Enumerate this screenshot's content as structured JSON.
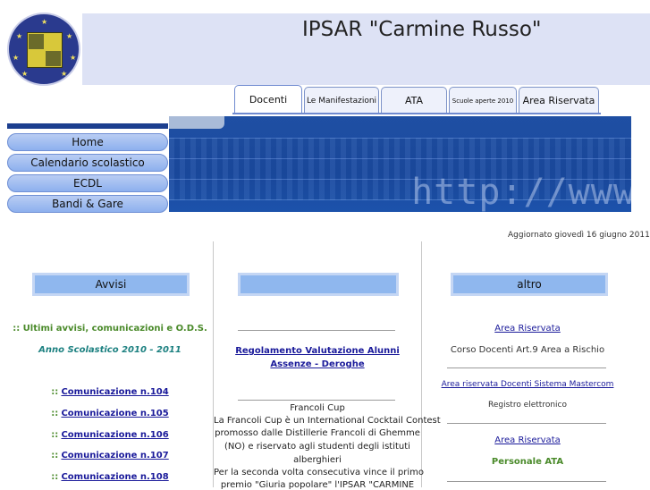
{
  "header": {
    "title": "IPSAR \"Carmine Russo\""
  },
  "tabs": [
    {
      "label": "Docenti",
      "active": true
    },
    {
      "label": "Le Manifestazioni"
    },
    {
      "label": "ATA"
    },
    {
      "label": "Scuole aperte 2010"
    },
    {
      "label": "Area Riservata"
    }
  ],
  "nav": {
    "items": [
      "Home",
      "Calendario scolastico",
      "ECDL",
      "Bandi & Gare"
    ]
  },
  "banner": {
    "text": "http://www."
  },
  "updated": "Aggiornato giovedì 16 giugno 2011",
  "left": {
    "header": "Avvisi",
    "subtitle": ":: Ultimi avvisi, comunicazioni  e O.D.S.",
    "year": "Anno Scolastico 2010 - 2011",
    "bullet": "::",
    "links": [
      "Comunicazione n.104",
      "Comunicazione n.105",
      "Comunicazione n.106",
      "Comunicazione n.107",
      "Comunicazione n.108"
    ]
  },
  "center": {
    "header": "",
    "link_line1": "Regolamento Valutazione Alunni",
    "link_line2": "Assenze - Deroghe",
    "news_title": "Francoli Cup",
    "news_lines": [
      "La Francoli Cup è un International Cocktail Contest",
      "promosso dalle Distillerie Francoli di Ghemme",
      "(NO) e riservato agli studenti degli istituti",
      "alberghieri",
      "Per la seconda volta consecutiva vince il primo",
      "premio \"Giuria popolare\" l'IPSAR \"CARMINE"
    ]
  },
  "right": {
    "header": "altro",
    "link1": "Area Riservata",
    "text1": "Corso Docenti Art.9 Area a Rischio",
    "link2": "Area riservata Docenti Sistema Mastercom",
    "text2": "Registro elettronico",
    "link3": "Area Riservata",
    "text3": "Personale ATA"
  }
}
